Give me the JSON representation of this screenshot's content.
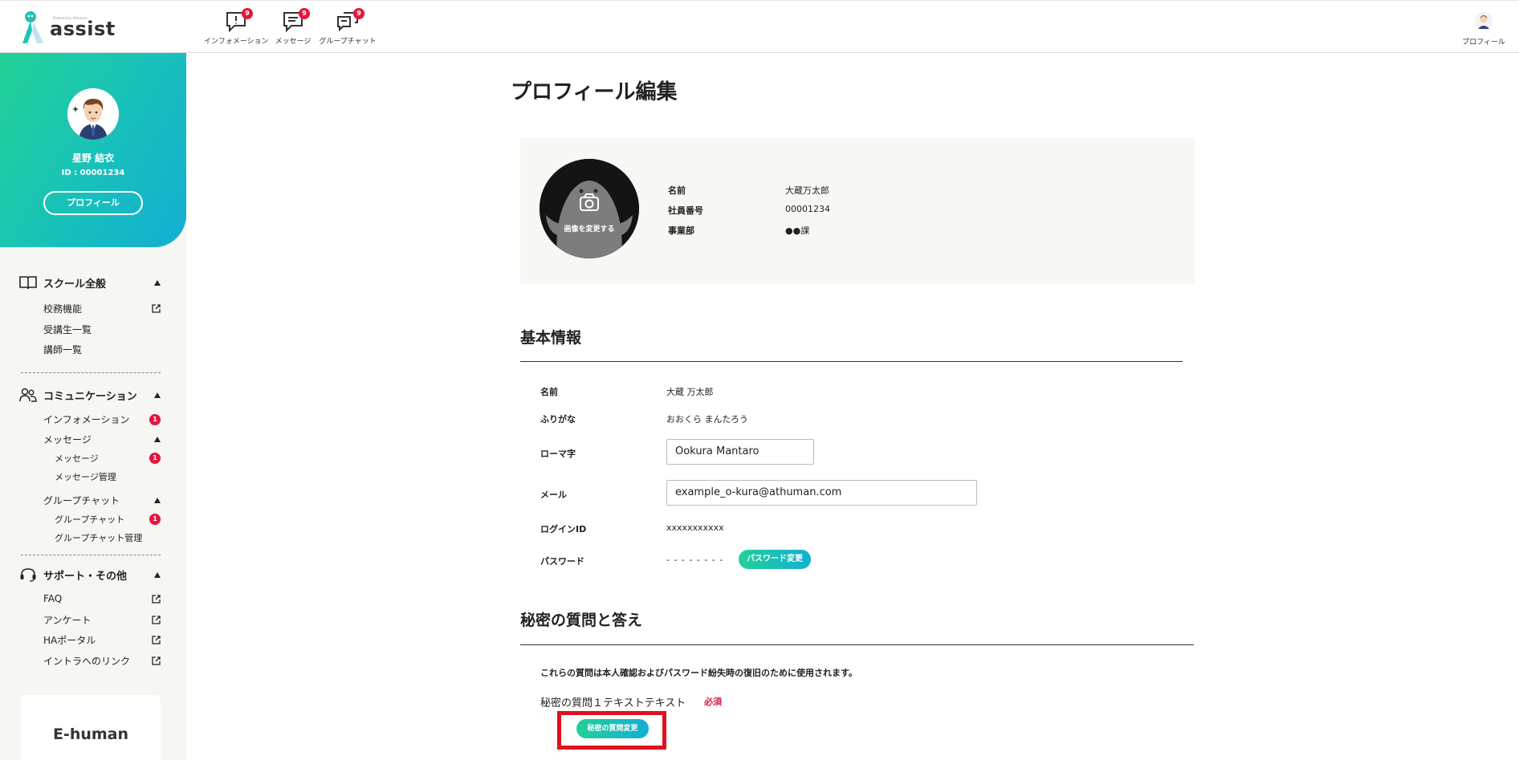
{
  "app": {
    "name": "assist",
    "tagline": "Powered by Athuman"
  },
  "header": {
    "nav": [
      {
        "label": "インフォメーション",
        "badge": "9",
        "icon": "info-bubble-icon"
      },
      {
        "label": "メッセージ",
        "badge": "9",
        "icon": "message-bubble-icon"
      },
      {
        "label": "グループチャット",
        "badge": "9",
        "icon": "group-chat-icon"
      }
    ],
    "profile_label": "プロフィール"
  },
  "sidebar": {
    "user_name": "星野 結衣",
    "user_id": "ID : 00001234",
    "profile_button": "プロフィール",
    "sections": [
      {
        "title": "スクール全般",
        "icon": "book-icon",
        "items": [
          {
            "label": "校務機能",
            "external": true
          },
          {
            "label": "受講生一覧"
          },
          {
            "label": "講師一覧"
          }
        ]
      },
      {
        "title": "コミュニケーション",
        "icon": "users-icon",
        "items": [
          {
            "label": "インフォメーション",
            "badge": "1"
          },
          {
            "label": "メッセージ",
            "collapsible": true,
            "children": [
              {
                "label": "メッセージ",
                "badge": "1"
              },
              {
                "label": "メッセージ管理"
              }
            ]
          },
          {
            "label": "グループチャット",
            "collapsible": true,
            "children": [
              {
                "label": "グループチャット",
                "badge": "1"
              },
              {
                "label": "グループチャット管理"
              }
            ]
          }
        ]
      },
      {
        "title": "サポート・その他",
        "icon": "headset-icon",
        "items": [
          {
            "label": "FAQ",
            "external": true
          },
          {
            "label": "アンケート",
            "external": true
          },
          {
            "label": "HAポータル",
            "external": true
          },
          {
            "label": "イントラへのリンク",
            "external": true
          }
        ]
      }
    ],
    "banner": "E-human"
  },
  "main": {
    "title": "プロフィール編集",
    "card": {
      "photo_label": "画像を変更する",
      "fields": [
        {
          "key": "名前",
          "value": "大蔵万太郎"
        },
        {
          "key": "社員番号",
          "value": "00001234"
        },
        {
          "key": "事業部",
          "value": "●●課"
        }
      ]
    },
    "basic": {
      "title": "基本情報",
      "name_label": "名前",
      "name_value": "大蔵 万太郎",
      "kana_label": "ふりがな",
      "kana_value": "おおくら まんたろう",
      "roman_label": "ローマ字",
      "roman_value": "Ookura Mantaro",
      "mail_label": "メール",
      "mail_value": "example_o-kura@athuman.com",
      "login_label": "ログインID",
      "login_value": "xxxxxxxxxxx",
      "pw_label": "パスワード",
      "pw_value": "- - - - - - - -",
      "pw_button": "パスワード変更"
    },
    "secret": {
      "title": "秘密の質問と答え",
      "note": "これらの質問は本人確認およびパスワード紛失時の復旧のために使用されます。",
      "q1": "秘密の質問１テキストテキスト",
      "required": "必須",
      "change_button": "秘密の質問変更"
    }
  },
  "colors": {
    "accent_green": "#22d196",
    "accent_blue": "#13aed4",
    "badge_red": "#e2173e",
    "highlight_red": "#e2101d"
  }
}
